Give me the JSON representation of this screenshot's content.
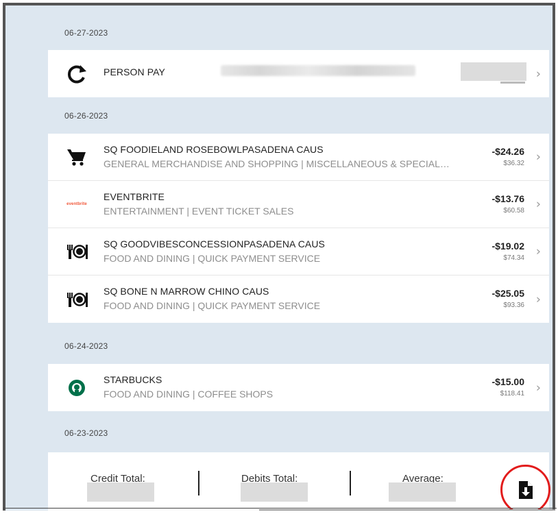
{
  "groups": [
    {
      "date": "06-27-2023",
      "transactions": [
        {
          "name": "PERSON PAY",
          "icon": "refresh-icon"
        }
      ]
    },
    {
      "date": "06-26-2023",
      "transactions": [
        {
          "name": "SQ FOODIELAND ROSEBOWLPASADENA CAUS",
          "category": "GENERAL MERCHANDISE AND SHOPPING | MISCELLANEOUS & SPECIAL…",
          "amount": "-$24.26",
          "balance": "$36.32",
          "icon": "cart-icon"
        },
        {
          "name": "EVENTBRITE",
          "category": "ENTERTAINMENT | EVENT TICKET SALES",
          "amount": "-$13.76",
          "balance": "$60.58",
          "icon": "eventbrite-logo"
        },
        {
          "name": "SQ GOODVIBESCONCESSIONPASADENA CAUS",
          "category": "FOOD AND DINING | QUICK PAYMENT SERVICE",
          "amount": "-$19.02",
          "balance": "$74.34",
          "icon": "dining-icon"
        },
        {
          "name": "SQ BONE N MARROW CHINO CAUS",
          "category": "FOOD AND DINING | QUICK PAYMENT SERVICE",
          "amount": "-$25.05",
          "balance": "$93.36",
          "icon": "dining-icon"
        }
      ]
    },
    {
      "date": "06-24-2023",
      "transactions": [
        {
          "name": "STARBUCKS",
          "category": "FOOD AND DINING | COFFEE SHOPS",
          "amount": "-$15.00",
          "balance": "$118.41",
          "icon": "starbucks-logo"
        }
      ]
    },
    {
      "date": "06-23-2023",
      "transactions": []
    }
  ],
  "summary": {
    "credit_label": "Credit Total:",
    "debits_label": "Debits Total:",
    "average_label": "Average:",
    "download_icon": "download-file-icon"
  },
  "colors": {
    "background": "#dde7f0",
    "highlight_circle": "#e21b1b",
    "eventbrite": "#f05537",
    "starbucks": "#00704a"
  }
}
